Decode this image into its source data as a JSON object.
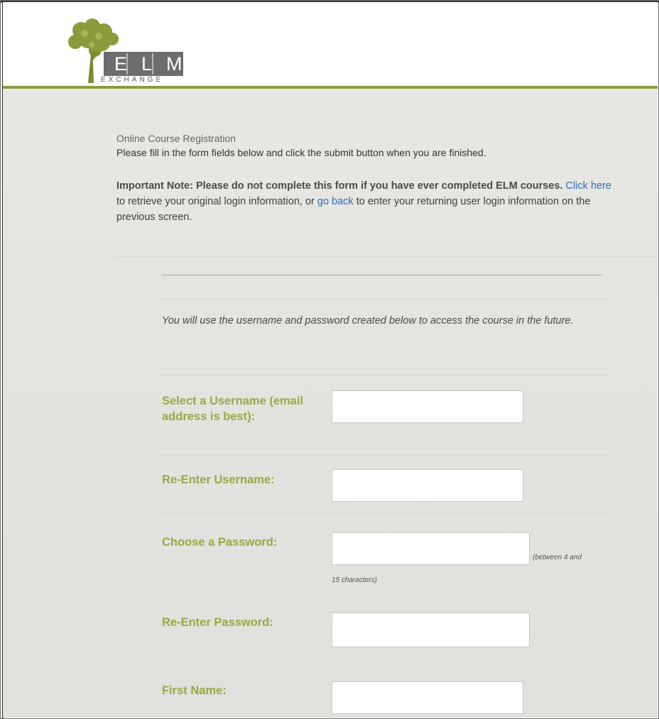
{
  "header": {
    "logo": {
      "wordmark": "ELM",
      "subtitle": "EXCHANGE"
    }
  },
  "intro": {
    "title": "Online Course Registration",
    "instructions": "Please fill in the form fields below and click the submit button when you are finished."
  },
  "note": {
    "bold_text": "Important Note: Please do not complete this form if you have ever completed ELM courses.",
    "link1": "Click here",
    "middle_text": "to retrieve your original login information, or",
    "link2": "go back",
    "end_text": "to enter your returning user login information on the previous screen."
  },
  "form": {
    "hint": "You will use the username and password created below to access the course in the future.",
    "fields": [
      {
        "label": "Select a Username (email address is best):",
        "value": ""
      },
      {
        "label": "Re-Enter Username:",
        "value": ""
      },
      {
        "label": "Choose a Password:",
        "value": "",
        "helper": "(between 4 and 15 characters)",
        "helper_part1": "(between 4 and",
        "helper_part2": "15 characters)"
      },
      {
        "label": "Re-Enter Password:",
        "value": ""
      },
      {
        "label": "First Name:",
        "value": ""
      }
    ]
  },
  "colors": {
    "accent_green": "#9aa744",
    "header_line": "#8e9a3a",
    "link_blue": "#2a6fc0",
    "logo_box": "#6d6d6d"
  }
}
